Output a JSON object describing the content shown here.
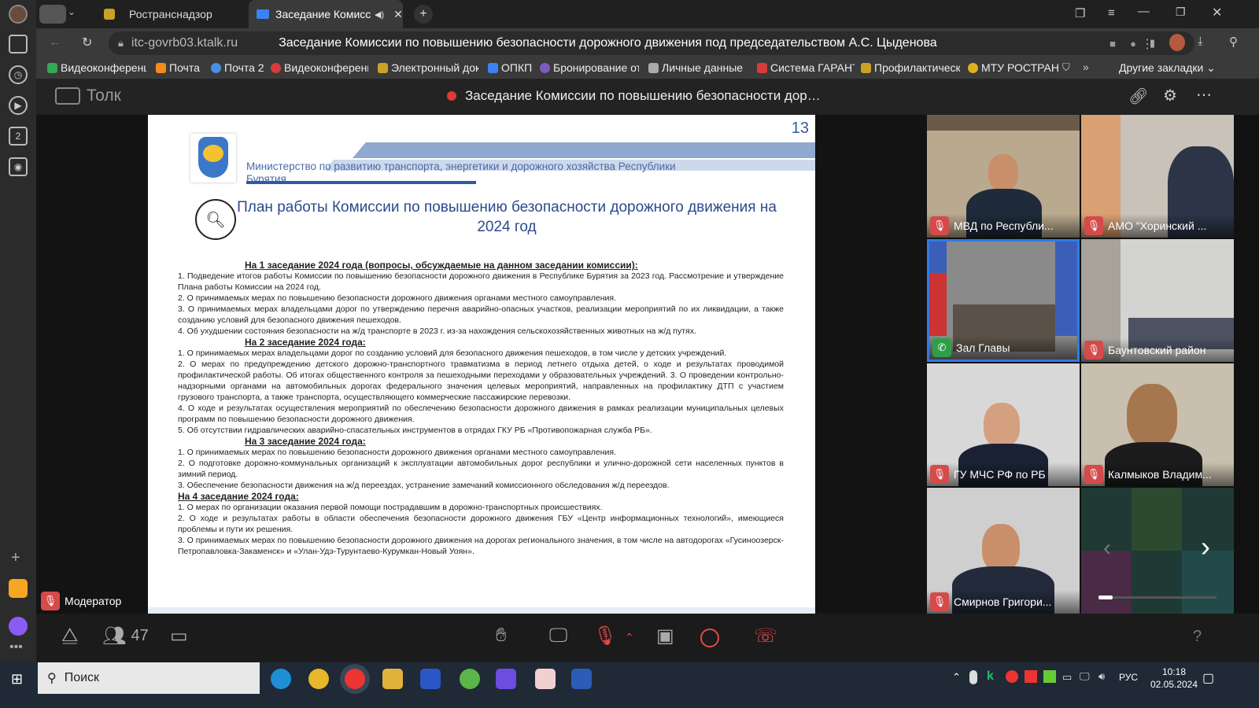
{
  "browser": {
    "tabs": [
      {
        "label": "Ространснадзор"
      },
      {
        "label": "Заседание Комисси"
      }
    ],
    "url": "itc-govrb03.ktalk.ru",
    "page_title": "Заседание Комиссии по повышению безопасности дорожного движения под председательством А.С. Цыденова",
    "bookmarks": [
      {
        "label": "Видеоконференц",
        "color": "#34a853"
      },
      {
        "label": "Почта",
        "color": "#f28b1c"
      },
      {
        "label": "Почта 2",
        "color": "#4a90e2"
      },
      {
        "label": "Видеоконференц",
        "color": "#d63c3c"
      },
      {
        "label": "Электронный док",
        "color": "#c9a227"
      },
      {
        "label": "ОПКП",
        "color": "#3b82f6"
      },
      {
        "label": "Бронирование от",
        "color": "#7c5cbf"
      },
      {
        "label": "Личные данные -",
        "color": "#aaaaaa"
      },
      {
        "label": "Система ГАРАНТ",
        "color": "#d63c3c"
      },
      {
        "label": "Профилактическ",
        "color": "#c9a227"
      },
      {
        "label": "МТУ РОСТРАН",
        "color": "#e0b020"
      }
    ],
    "other_bookmarks": "Другие закладки"
  },
  "app": {
    "name": "Толк",
    "meeting_title": "Заседание Комиссии по повышению безопасности дор…"
  },
  "slide": {
    "page_number": "13",
    "ministry": "Министерство по развитию транспорта, энергетики и дорожного хозяйства Республики Бурятия",
    "title_line1": "План работы Комиссии по повышению безопасности дорожного движения на",
    "title_line2": "2024 год",
    "h1": "На 1 заседание 2024 года (вопросы, обсуждаемые на данном заседании комиссии):",
    "s1": [
      "1.   Подведение итогов работы Комиссии по повышению безопасности дорожного движения в Республике Бурятия за 2023 год. Рассмотрение и утверждение Плана работы Комиссии на 2024 год.",
      "2. О принимаемых мерах по повышению безопасности дорожного движения органами местного самоуправления.",
      "3. О принимаемых мерах владельцами дорог по  утверждению перечня аварийно-опасных участков, реализации мероприятий по их ликвидации, а также созданию условий для безопасного движения пешеходов.",
      "4. Об ухудшении состояния безопасности на ж/д транспорте в 2023 г. из-за нахождения сельскохозяйственных животных на ж/д путях."
    ],
    "h2": "На 2 заседание 2024 года:",
    "s2": [
      "1.   О принимаемых мерах владельцами дорог по созданию условий для безопасного движения пешеходов, в том числе у детских учреждений.",
      "2. О мерах по предупреждению детского дорожно-транспортного травматизма в период летнего отдыха детей, о ходе и результатах проводимой профилактической работы.  Об итогах общественного контроля за пешеходными переходами у образовательных учреждений. 3. О проведении контрольно-надзорными органами на автомобильных дорогах федерального значения целевых мероприятий, направленных на профилактику ДТП с участием грузового транспорта, а также транспорта, осуществляющего коммерческие пассажирские перевозки.",
      "4. О ходе и результатах осуществления мероприятий по обеспечению безопасности дорожного движения в рамках реализации муниципальных целевых программ по повышению безопасности дорожного движения.",
      "5. Об отсутствии гидравлических аварийно-спасательных инструментов в отрядах ГКУ РБ «Противопожарная служба РБ»."
    ],
    "h3": "На 3 заседание 2024 года:",
    "s3": [
      "1. О принимаемых мерах по повышению безопасности дорожного движения органами местного самоуправления.",
      "2. О подготовке дорожно-коммунальных организаций к эксплуатации автомобильных дорог республики и улично-дорожной сети населенных пунктов в зимний период.",
      "3. Обеспечение безопасности движения на ж/д переездах, устранение замечаний комиссионного обследования ж/д переездов."
    ],
    "h4": "На 4 заседание 2024 года:",
    "s4": [
      "1. О мерах по организации оказания первой помощи пострадавшим в дорожно-транспортных происшествиях.",
      "2. О ходе и результатах работы в области обеспечения безопасности дорожного движения ГБУ «Центр информационных технологий», имеющиеся проблемы и пути их решения.",
      "3. О принимаемых мерах по повышению безопасности дорожного движения на дорогах регионального значения, в том числе на автодорогах «Гусиноозерск-Петропавловка-Закаменск» и «Улан-Удэ-Турунтаево-Курумкан-Новый Уоян»."
    ]
  },
  "presenter": {
    "label": "Модератор"
  },
  "participants": [
    {
      "name": "МВД по Республи...",
      "muted": true
    },
    {
      "name": "АМО \"Хоринский ...",
      "muted": true
    },
    {
      "name": "Зал Главы",
      "muted": false
    },
    {
      "name": "Баунтовский район",
      "muted": true
    },
    {
      "name": "ГУ МЧС РФ по РБ",
      "muted": true
    },
    {
      "name": "Калмыков Владим...",
      "muted": true
    },
    {
      "name": "Смирнов Григори...",
      "muted": true
    }
  ],
  "controls": {
    "participants_count": "47",
    "help": "?"
  },
  "taskbar": {
    "search": "Поиск",
    "lang": "РУС",
    "time": "10:18",
    "date": "02.05.2024"
  }
}
